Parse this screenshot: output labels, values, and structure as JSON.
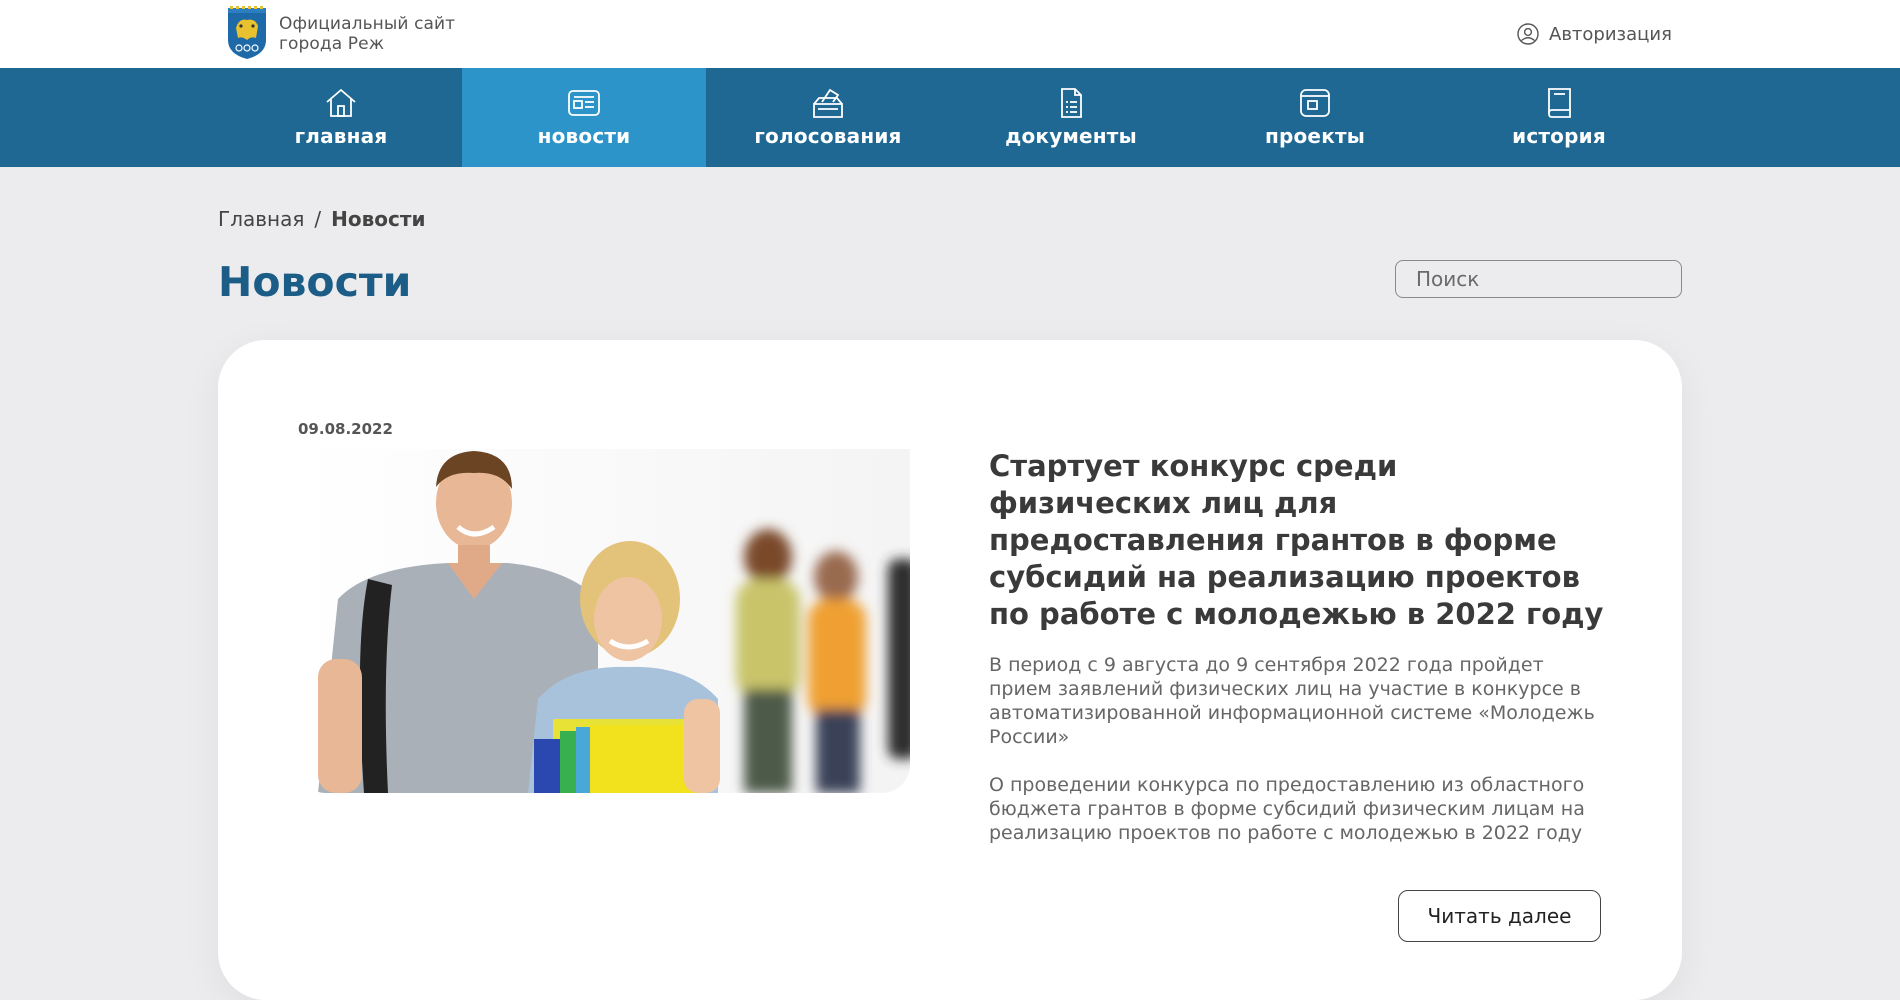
{
  "header": {
    "site_title_line1": "Официальный сайт",
    "site_title_line2": "города Реж",
    "logo_icon": "coat-of-arms-icon",
    "auth_label": "Авторизация",
    "auth_icon": "user-circle-icon"
  },
  "nav": {
    "items": [
      {
        "label": "главная",
        "icon": "home-icon"
      },
      {
        "label": "новости",
        "icon": "newspaper-icon",
        "active": true
      },
      {
        "label": "голосования",
        "icon": "ballot-box-icon"
      },
      {
        "label": "документы",
        "icon": "document-icon"
      },
      {
        "label": "проекты",
        "icon": "window-icon"
      },
      {
        "label": "история",
        "icon": "book-icon"
      }
    ],
    "bg_color": "#1f6893",
    "active_color": "#2d94c9"
  },
  "breadcrumb": {
    "home": "Главная",
    "separator": "/",
    "current": "Новости"
  },
  "page": {
    "title": "Новости",
    "search_placeholder": "Поиск"
  },
  "news": {
    "date": "09.08.2022",
    "title": "Стартует конкурс среди физических лиц для предоставления грантов в форме субсидий на реализацию проектов по работе с молодежью в 2022 году",
    "lead": "В период с 9 августа до 9 сентября 2022 года пройдет прием заявлений физических лиц на участие в конкурсе в автоматизированной информационной системе «Молодежь России»",
    "body": "О проведении конкурса по предоставлению из областного бюджета грантов в форме субсидий физическим лицам на реализацию проектов по работе с молодежью в 2022 году",
    "read_more": "Читать далее"
  },
  "colors": {
    "title_blue": "#1b5d86",
    "page_bg": "#ececee"
  }
}
